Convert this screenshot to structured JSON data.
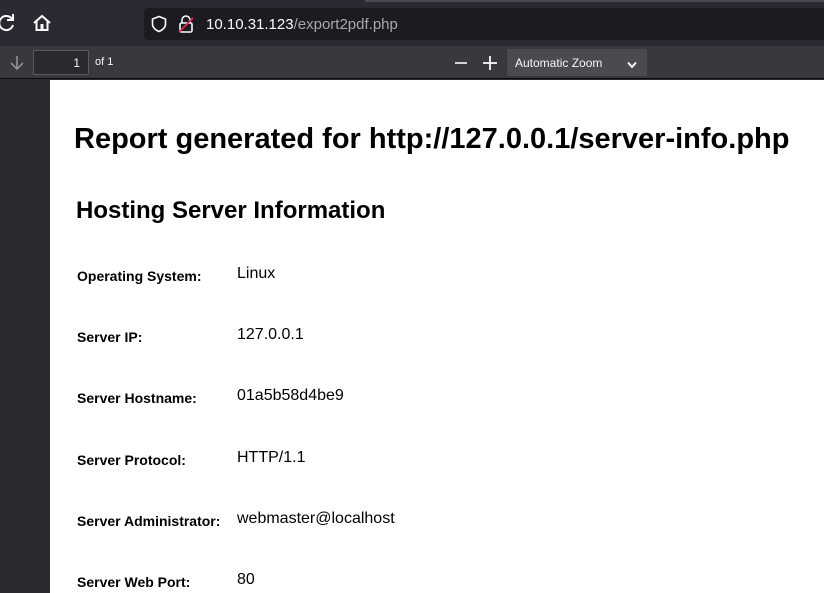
{
  "browser": {
    "url_host": "10.10.31.123",
    "url_path": "/export2pdf.php"
  },
  "pdf_toolbar": {
    "page_number": "1",
    "page_count": "of 1",
    "zoom": "Automatic Zoom"
  },
  "report": {
    "title": "Report generated for http://127.0.0.1/server-info.php",
    "section_title": "Hosting Server Information",
    "rows": [
      {
        "label": "Operating System:",
        "value": "Linux"
      },
      {
        "label": "Server IP:",
        "value": "127.0.0.1"
      },
      {
        "label": "Server Hostname:",
        "value": "01a5b58d4be9"
      },
      {
        "label": "Server Protocol:",
        "value": "HTTP/1.1"
      },
      {
        "label": "Server Administrator:",
        "value": "webmaster@localhost"
      },
      {
        "label": "Server Web Port:",
        "value": "80"
      }
    ]
  },
  "icons": [
    "reload-icon",
    "home-icon",
    "shield-icon",
    "lock-icon",
    "down-arrow-icon",
    "minus-icon",
    "plus-icon",
    "chevron-down-icon"
  ]
}
